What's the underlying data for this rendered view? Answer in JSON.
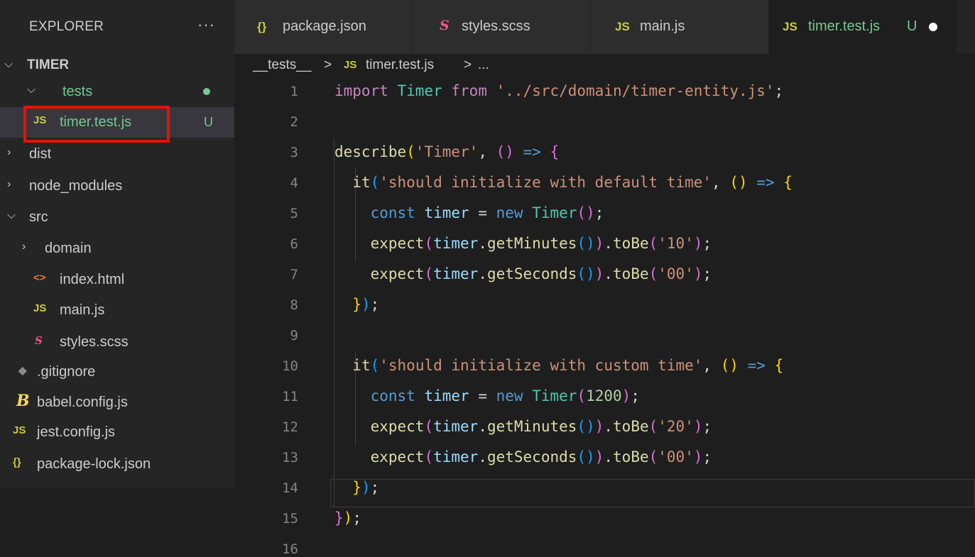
{
  "sidebar": {
    "title": "EXPLORER",
    "more_label": "···",
    "section": "TIMER",
    "items": [
      {
        "name": "tests",
        "icon": "",
        "type": "folder-open"
      },
      {
        "name": "timer.test.js",
        "icon": "JS",
        "status": "U"
      },
      {
        "name": "dist",
        "icon": "",
        "type": "folder-closed"
      },
      {
        "name": "node_modules",
        "icon": "",
        "type": "folder-closed"
      },
      {
        "name": "src",
        "icon": "",
        "type": "folder-open"
      },
      {
        "name": "domain",
        "icon": "",
        "type": "folder-closed"
      },
      {
        "name": "index.html",
        "icon": "<>"
      },
      {
        "name": "main.js",
        "icon": "JS"
      },
      {
        "name": "styles.scss",
        "icon": "S"
      },
      {
        "name": ".gitignore",
        "icon": "◆"
      },
      {
        "name": "babel.config.js",
        "icon": "B"
      },
      {
        "name": "jest.config.js",
        "icon": "JS"
      },
      {
        "name": "package-lock.json",
        "icon": "{}"
      }
    ]
  },
  "tabs": [
    {
      "name": "package.json",
      "icon": "{}"
    },
    {
      "name": "styles.scss",
      "icon": "S"
    },
    {
      "name": "main.js",
      "icon": "JS"
    },
    {
      "name": "timer.test.js",
      "icon": "JS",
      "status": "U",
      "active": true
    }
  ],
  "breadcrumb": {
    "folder": "__tests__",
    "sep1": ">",
    "icon": "JS",
    "file": "timer.test.js",
    "sep2": ">",
    "more": "..."
  },
  "code": {
    "line_numbers": [
      "1",
      "2",
      "3",
      "4",
      "5",
      "6",
      "7",
      "8",
      "9",
      "10",
      "11",
      "12",
      "13",
      "14",
      "15",
      "16"
    ],
    "lines": [
      "import Timer from '../src/domain/timer-entity.js';",
      "",
      "describe('Timer', () => {",
      "  it('should initialize with default time', () => {",
      "    const timer = new Timer();",
      "    expect(timer.getMinutes()).toBe('10');",
      "    expect(timer.getSeconds()).toBe('00');",
      "  });",
      "",
      "  it('should initialize with custom time', () => {",
      "    const timer = new Timer(1200);",
      "    expect(timer.getMinutes()).toBe('20');",
      "    expect(timer.getSeconds()).toBe('00');",
      "  });",
      "});",
      ""
    ]
  },
  "colors": {
    "keyword": "#c586c0",
    "class": "#4ec9b0",
    "string": "#ce9178",
    "function": "#dcdcaa",
    "variable": "#9cdcfe",
    "untracked": "#73c991",
    "js_icon": "#cbcb41",
    "highlight_box": "#e51400"
  }
}
